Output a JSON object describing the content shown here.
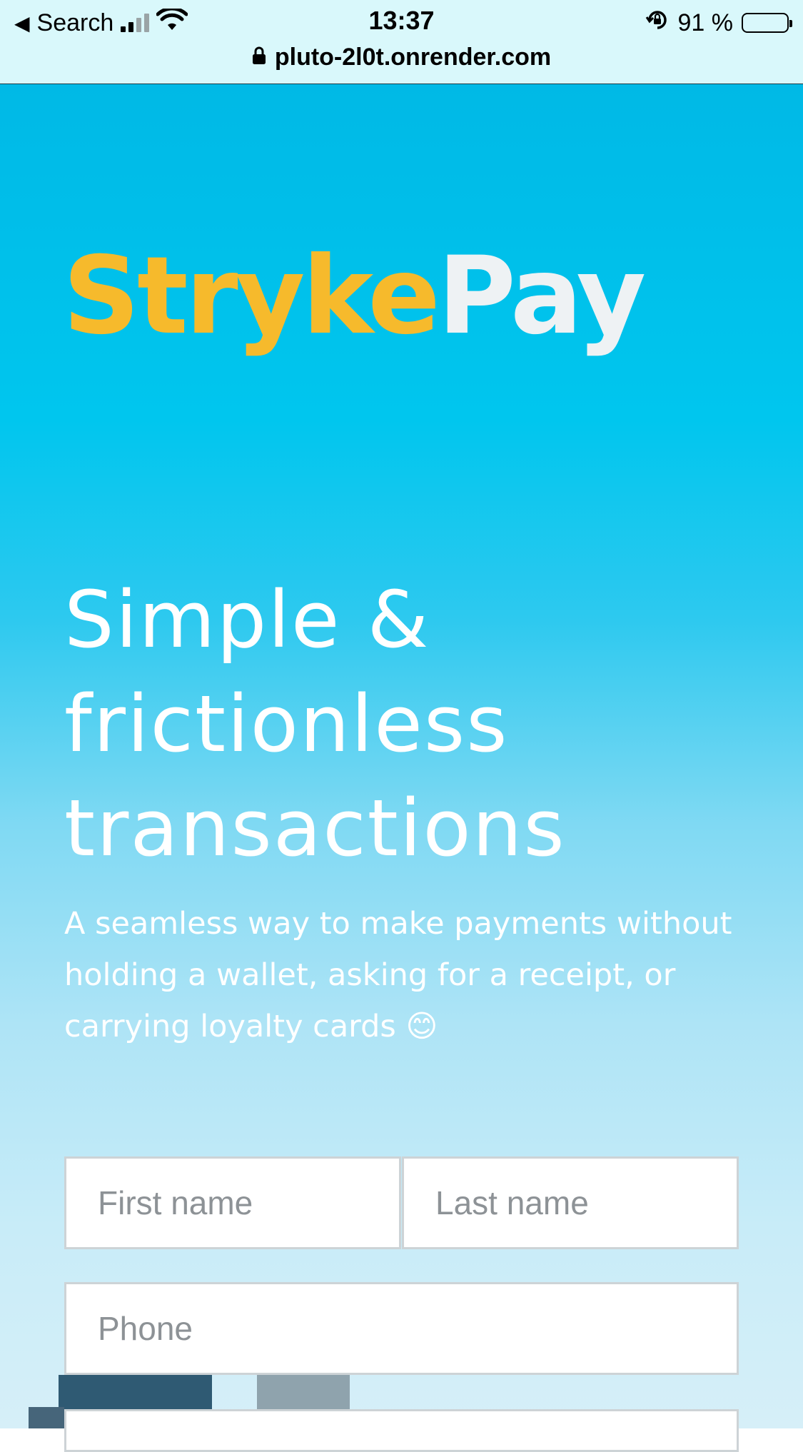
{
  "status_bar": {
    "back_label": "Search",
    "time": "13:37",
    "battery": "91 %",
    "battery_level": 0.91,
    "url": "pluto-2l0t.onrender.com"
  },
  "brand": {
    "part1": "Stryke",
    "part2": "Pay",
    "part1_color": "#f6ba2c",
    "part2_color": "#eef2f4"
  },
  "hero": {
    "line1": "Simple &",
    "line2": "frictionless",
    "line3": "transactions",
    "subtext": "A seamless way to make payments without holding a wallet, asking for a receipt, or carrying loyalty cards",
    "emoji": "😊"
  },
  "form": {
    "first_name_placeholder": "First name",
    "last_name_placeholder": "Last name",
    "phone_placeholder": "Phone"
  },
  "icons": [
    "back-arrow-icon",
    "cellular-signal-icon",
    "wifi-icon",
    "rotation-lock-icon",
    "battery-icon",
    "lock-icon",
    "smiling-emoji-icon"
  ]
}
